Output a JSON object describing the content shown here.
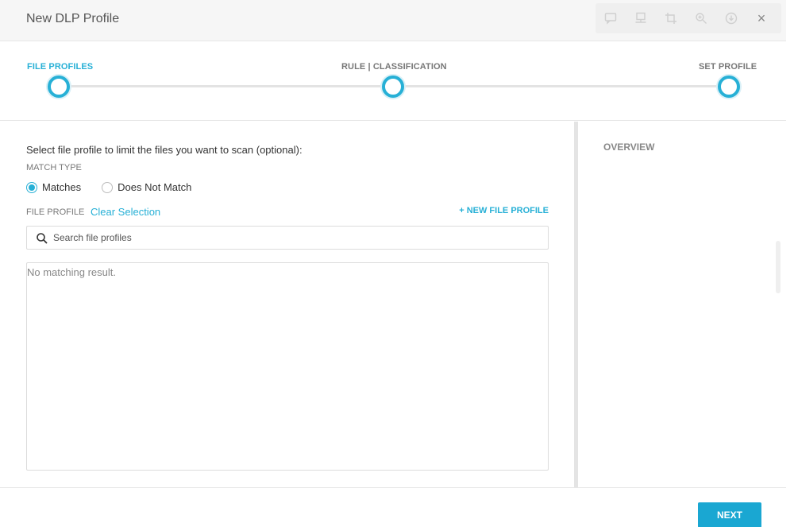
{
  "window": {
    "title": "New DLP Profile"
  },
  "toolbar": {
    "icons": [
      "comment-icon",
      "presenter-icon",
      "crop-icon",
      "zoom-icon",
      "download-icon"
    ],
    "close_label": "×"
  },
  "stepper": {
    "steps": [
      {
        "label": "FILE PROFILES",
        "active": true
      },
      {
        "label": "RULE | CLASSIFICATION",
        "active": false
      },
      {
        "label": "SET PROFILE",
        "active": false
      }
    ]
  },
  "main": {
    "intro": "Select file profile to limit the files you want to scan (optional):",
    "match_type_label": "MATCH TYPE",
    "match_options": [
      {
        "label": "Matches",
        "selected": true
      },
      {
        "label": "Does Not Match",
        "selected": false
      }
    ],
    "file_profile_label": "FILE PROFILE",
    "clear_selection": "Clear Selection",
    "new_file_profile": "+ NEW FILE PROFILE",
    "search": {
      "placeholder": "Search file profiles",
      "value": ""
    },
    "empty_result": "No matching result."
  },
  "overview": {
    "label": "OVERVIEW"
  },
  "footer": {
    "next_label": "NEXT"
  },
  "colors": {
    "accent": "#27b0d6",
    "button": "#1aa7d2"
  }
}
